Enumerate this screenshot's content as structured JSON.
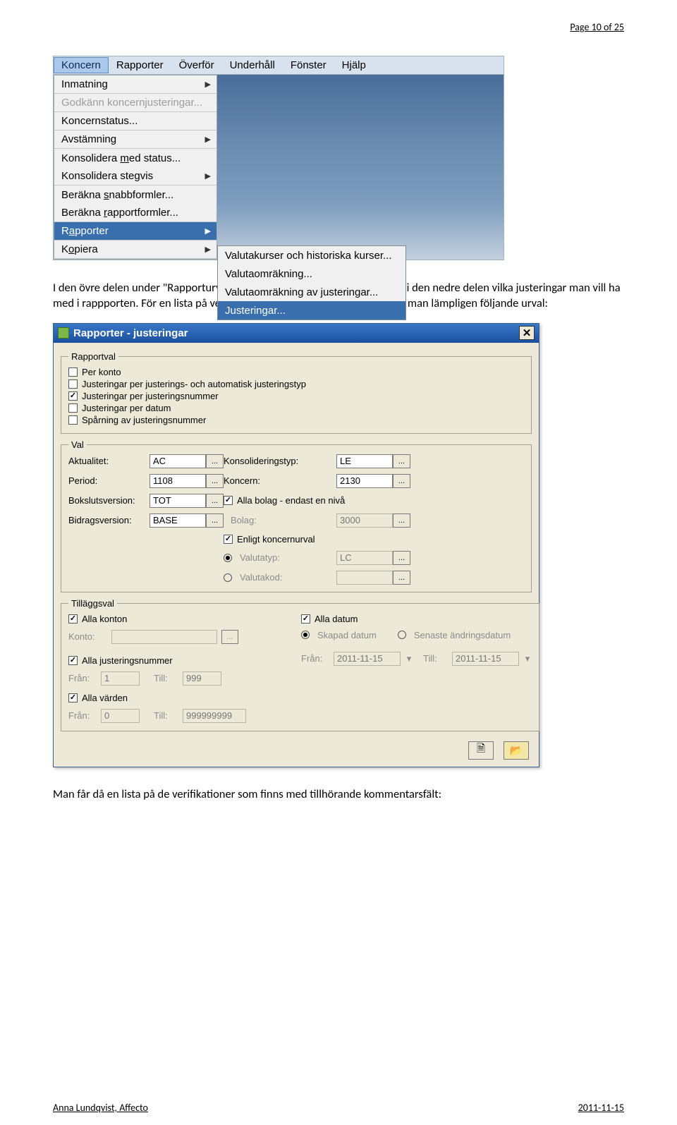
{
  "page_header": "Page 10 of 25",
  "menubar": [
    "Koncern",
    "Rapporter",
    "Överför",
    "Underhåll",
    "Fönster",
    "Hjälp"
  ],
  "dropdown": [
    {
      "label": "Inmatning",
      "arrow": true
    },
    {
      "label": "Godkänn koncernjusteringar...",
      "disabled": true
    },
    {
      "label": "Koncernstatus..."
    },
    {
      "label": "Avstämning",
      "arrow": true
    },
    {
      "label": "Konsolidera med status...",
      "nosep": true
    },
    {
      "label": "Konsolidera stegvis",
      "arrow": true
    },
    {
      "label": "Beräkna snabbformler...",
      "nosep": true
    },
    {
      "label": "Beräkna rapportformler..."
    },
    {
      "label": "Rapporter",
      "arrow": true,
      "highlight": true
    },
    {
      "label": "Kopiera",
      "arrow": true
    }
  ],
  "submenu": [
    {
      "label": "Valutakurser och historiska kurser..."
    },
    {
      "label": "Valutaomräkning..."
    },
    {
      "label": "Valutaomräkning av justeringar..."
    },
    {
      "label": "Justeringar...",
      "highlight": true
    }
  ],
  "paragraph1": "I den övre delen under \"Rapporturval\" väljer man sorteringsordningen och i den nedre delen vilka justeringar man vill ha med i rappporten. För en lista på verifikationer på manuella justeringar gör man lämpligen följande urval:",
  "dialog": {
    "title": "Rapporter - justeringar",
    "rapportval_legend": "Rapportval",
    "rapportval": [
      {
        "label": "Per konto",
        "checked": false
      },
      {
        "label": "Justeringar per justerings- och automatisk justeringstyp",
        "checked": false
      },
      {
        "label": "Justeringar per justeringsnummer",
        "checked": true
      },
      {
        "label": "Justeringar per datum",
        "checked": false
      },
      {
        "label": "Spårning av justeringsnummer",
        "checked": false
      }
    ],
    "val_legend": "Val",
    "val": {
      "aktualitet": {
        "label": "Aktualitet:",
        "value": "AC"
      },
      "period": {
        "label": "Period:",
        "value": "1108"
      },
      "bokslutsversion": {
        "label": "Bokslutsversion:",
        "value": "TOT"
      },
      "bidragsversion": {
        "label": "Bidragsversion:",
        "value": "BASE"
      },
      "konsolideringstyp": {
        "label": "Konsolideringstyp:",
        "value": "LE"
      },
      "koncern": {
        "label": "Koncern:",
        "value": "2130"
      },
      "alla_bolag": {
        "label": "Alla bolag - endast en nivå",
        "checked": true
      },
      "bolag": {
        "label": "Bolag:",
        "value": "3000"
      },
      "enligt_koncernurval": {
        "label": "Enligt koncernurval",
        "checked": true
      },
      "valutatyp": {
        "label": "Valutatyp:",
        "value": "LC"
      },
      "valutakod": {
        "label": "Valutakod:",
        "value": ""
      }
    },
    "tillaggsval_legend": "Tilläggsval",
    "tillaggsval": {
      "alla_konton": {
        "label": "Alla konton",
        "checked": true
      },
      "konto": {
        "label": "Konto:",
        "value": ""
      },
      "alla_justeringsnummer": {
        "label": "Alla justeringsnummer",
        "checked": true
      },
      "fran_label": "Från:",
      "till_label": "Till:",
      "fran_just": "1",
      "till_just": "999",
      "alla_varden": {
        "label": "Alla värden",
        "checked": true
      },
      "fran_varde": "0",
      "till_varde": "999999999",
      "alla_datum": {
        "label": "Alla datum",
        "checked": true
      },
      "skapad_datum": "Skapad datum",
      "senaste_andring": "Senaste ändringsdatum",
      "datum_fran": "2011-11-15",
      "datum_till": "2011-11-15"
    },
    "ellipsis": "..."
  },
  "paragraph2": "Man får då en lista på de verifikationer som finns med tillhörande kommentarsfält:",
  "footer_left": "Anna Lundqvist, Affecto",
  "footer_right": "2011-11-15"
}
